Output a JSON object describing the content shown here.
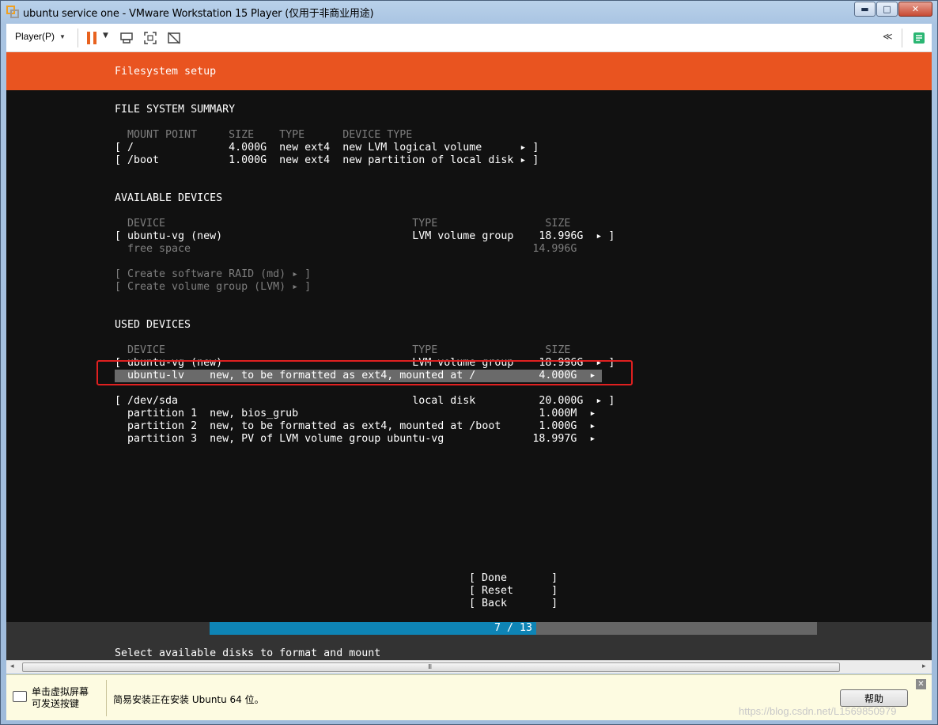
{
  "window": {
    "title": "ubuntu service one - VMware Workstation 15 Player (仅用于非商业用途)",
    "buttons": {
      "minimize": "▬",
      "maximize": "□",
      "close": "✕"
    }
  },
  "toolbar": {
    "player_menu": "Player(P)",
    "dropdown_arrow": "▼",
    "collapse": "≪"
  },
  "installer": {
    "header_title": "Filesystem setup",
    "fs_summary": {
      "heading": "FILE SYSTEM SUMMARY",
      "columns": "  MOUNT POINT     SIZE    TYPE      DEVICE TYPE",
      "rows": [
        "[ /               4.000G  new ext4  new LVM logical volume      ▸ ]",
        "[ /boot           1.000G  new ext4  new partition of local disk ▸ ]"
      ]
    },
    "available": {
      "heading": "AVAILABLE DEVICES",
      "columns": "  DEVICE                                       TYPE                 SIZE",
      "rows": [
        "[ ubuntu-vg (new)                              LVM volume group    18.996G  ▸ ]",
        "  free space                                                      14.996G"
      ],
      "actions": [
        "[ Create software RAID (md) ▸ ]",
        "[ Create volume group (LVM) ▸ ]"
      ]
    },
    "used": {
      "heading": "USED DEVICES",
      "columns": "  DEVICE                                       TYPE                 SIZE",
      "vg_row": "[ ubuntu-vg (new)                              LVM volume group    18.996G  ▸ ]",
      "lv_row": "  ubuntu-lv    new, to be formatted as ext4, mounted at /          4.000G  ▸",
      "disk_rows": [
        "[ /dev/sda                                     local disk          20.000G  ▸ ]",
        "  partition 1  new, bios_grub                                      1.000M  ▸",
        "  partition 2  new, to be formatted as ext4, mounted at /boot      1.000G  ▸",
        "  partition 3  new, PV of LVM volume group ubuntu-vg              18.997G  ▸"
      ]
    },
    "buttons": {
      "done": "[ Done       ]",
      "reset": "[ Reset      ]",
      "back": "[ Back       ]"
    },
    "progress": {
      "label": "7 / 13",
      "fraction": 0.538
    },
    "footer_hint": "Select available disks to format and mount"
  },
  "scrollbar": {
    "left_arrow": "◂",
    "right_arrow": "▸",
    "grip": "III"
  },
  "infobar": {
    "click_hint_line1": "单击虚拟屏幕",
    "click_hint_line2": "可发送按键",
    "message": "简易安装正在安装 Ubuntu 64 位。",
    "help_button": "帮助",
    "close": "✕",
    "watermark": "https://blog.csdn.net/L1569850979"
  },
  "colors": {
    "header_orange": "#e95420",
    "progress_blue": "#0e84b5",
    "terminal_bg": "#111111",
    "highlight_box": "#e02020"
  }
}
